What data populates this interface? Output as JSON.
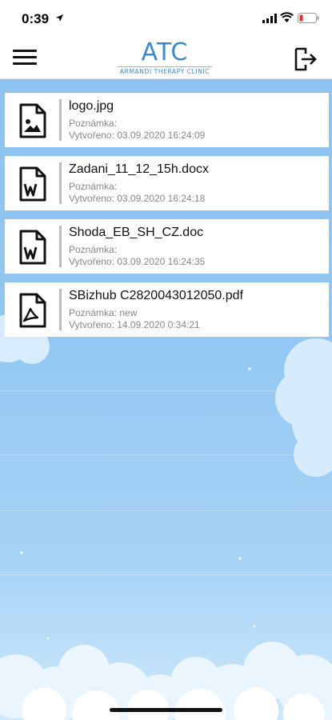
{
  "status_bar": {
    "time": "0:39"
  },
  "header": {
    "logo_text": "ATC",
    "logo_subtitle": "ARMANDI THERAPY CLINIC",
    "menu_icon": "hamburger-menu-icon",
    "logout_icon": "logout-icon"
  },
  "files": [
    {
      "name": "logo.jpg",
      "note": "Poznámka:",
      "created": "Vytvořeno: 03.09.2020 16:24:09",
      "icon": "image-file-icon"
    },
    {
      "name": "Zadani_11_12_15h.docx",
      "note": "Poznámka:",
      "created": "Vytvořeno: 03.09.2020 16:24:18",
      "icon": "word-file-icon"
    },
    {
      "name": "Shoda_EB_SH_CZ.doc",
      "note": "Poznámka:",
      "created": "Vytvořeno: 03.09.2020 16:24:35",
      "icon": "word-file-icon"
    },
    {
      "name": "SBizhub C2820043012050.pdf",
      "note": "Poznámka: new",
      "created": "Vytvořeno: 14.09.2020 0:34:21",
      "icon": "pdf-file-icon"
    }
  ],
  "colors": {
    "accent": "#3b8ad0",
    "sky_top": "#8fc3f0",
    "sky_bottom": "#cfe8fb"
  }
}
